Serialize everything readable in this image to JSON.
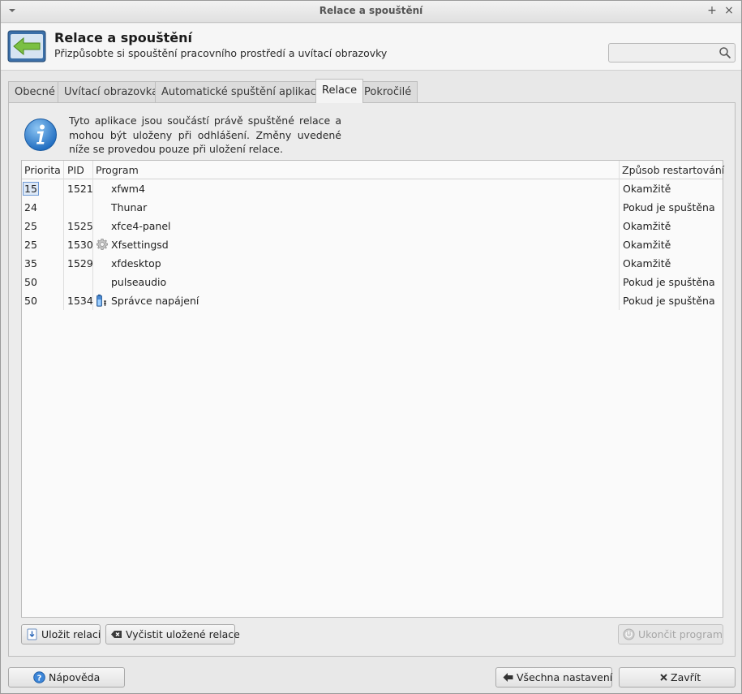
{
  "window": {
    "title": "Relace a spouštění"
  },
  "header": {
    "title": "Relace a spouštění",
    "subtitle": "Přizpůsobte si spouštění pracovního prostředí a uvítací obrazovky",
    "search": {
      "value": "",
      "placeholder": ""
    }
  },
  "tabs": [
    {
      "label": "Obecné",
      "active": false
    },
    {
      "label": "Uvítací obrazovka",
      "active": false
    },
    {
      "label": "Automatické spuštění aplikace",
      "active": false
    },
    {
      "label": "Relace",
      "active": true
    },
    {
      "label": "Pokročilé",
      "active": false
    }
  ],
  "info": {
    "text": "Tyto aplikace jsou součástí právě spuštěné relace a mohou být uloženy při odhlášení. Změny uvedené níže se provedou pouze při uložení relace."
  },
  "table": {
    "columns": {
      "priority": "Priorita",
      "pid": "PID",
      "program": "Program",
      "restart": "Způsob restartování"
    },
    "rows": [
      {
        "priority": "15",
        "pid": "1521",
        "program": "xfwm4",
        "restart": "Okamžitě",
        "icon": ""
      },
      {
        "priority": "24",
        "pid": "",
        "program": "Thunar",
        "restart": "Pokud je spuštěna",
        "icon": ""
      },
      {
        "priority": "25",
        "pid": "1525",
        "program": "xfce4-panel",
        "restart": "Okamžitě",
        "icon": ""
      },
      {
        "priority": "25",
        "pid": "1530",
        "program": "Xfsettingsd",
        "restart": "Okamžitě",
        "icon": "gear-icon"
      },
      {
        "priority": "35",
        "pid": "1529",
        "program": "xfdesktop",
        "restart": "Okamžitě",
        "icon": ""
      },
      {
        "priority": "50",
        "pid": "",
        "program": "pulseaudio",
        "restart": "Pokud je spuštěna",
        "icon": ""
      },
      {
        "priority": "50",
        "pid": "1534",
        "program": "Správce napájení",
        "restart": "Pokud je spuštěna",
        "icon": "battery-icon"
      }
    ]
  },
  "actions": {
    "save_session": "Uložit relaci",
    "clear_sessions": "Vyčistit uložené relace",
    "quit_program": "Ukončit program"
  },
  "footer": {
    "help": "Nápověda",
    "all_settings": "Všechna nastavení",
    "close": "Zavřít"
  },
  "colors": {
    "accent": "#4a90d9",
    "window_bg": "#e8e8e8",
    "table_bg": "#fafafa"
  }
}
